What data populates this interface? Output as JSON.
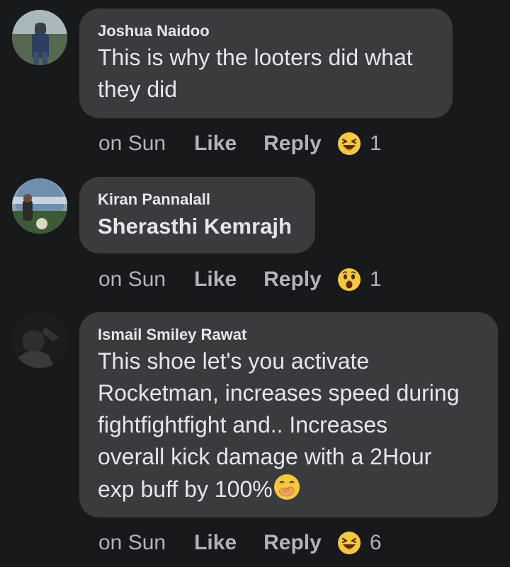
{
  "comments": [
    {
      "author": "Joshua Naidoo",
      "text": "This is why the looters did what they did",
      "time": "on Sun",
      "like_label": "Like",
      "reply_label": "Reply",
      "reaction_icon": "laughing-face",
      "reaction_count": "1"
    },
    {
      "author": "Kiran Pannalall",
      "text": "Sherasthi Kemrajh",
      "time": "on Sun",
      "like_label": "Like",
      "reply_label": "Reply",
      "reaction_icon": "wow-face",
      "reaction_count": "1"
    },
    {
      "author": "Ismail Smiley Rawat",
      "text_lines": [
        "This shoe let's you activate",
        "Rocketman, increases speed during",
        "fightfightfight and.. Increases",
        "overall kick damage with a 2Hour",
        "exp buff by 100%"
      ],
      "inline_emoji": "hand-over-mouth-face",
      "time": "on Sun",
      "like_label": "Like",
      "reply_label": "Reply",
      "reaction_icon": "laughing-face",
      "reaction_count": "6"
    }
  ],
  "colors": {
    "background": "#18191a",
    "bubble": "#3a3b3c",
    "text": "#e4e6eb",
    "secondary_text": "#b0b3b8",
    "emoji_yellow": "#f7c83e"
  }
}
